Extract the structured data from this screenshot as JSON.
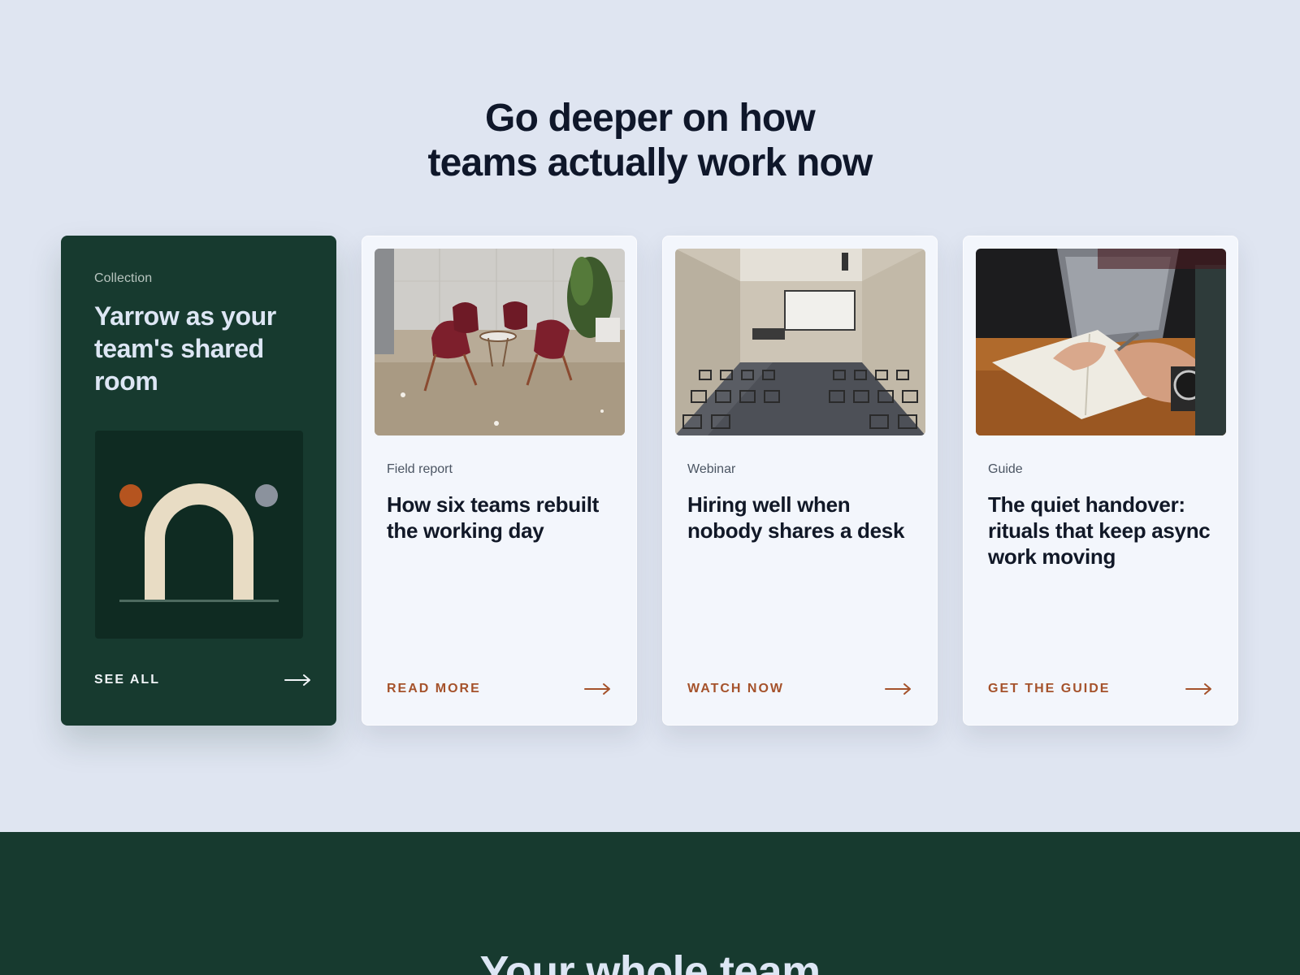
{
  "section": {
    "headline_line1": "Go deeper on how",
    "headline_line2": "teams actually work now"
  },
  "feature_card": {
    "kicker": "Collection",
    "title": "Yarrow as your team's shared room",
    "cta_label": "SEE ALL",
    "icons": {
      "art": "arch-illustration",
      "arrow": "arrow-right-icon"
    },
    "colors": {
      "background": "#173a2f",
      "arch": "#e8dcc4",
      "dot_left": "#b5541f",
      "dot_right": "#8b929d"
    }
  },
  "articles": [
    {
      "kicker": "Field report",
      "title": "How six teams rebuilt the working day",
      "cta_label": "READ MORE",
      "image": "lounge-chairs-photo"
    },
    {
      "kicker": "Webinar",
      "title": "Hiring well when nobody shares a desk",
      "cta_label": "WATCH NOW",
      "image": "conference-room-photo"
    },
    {
      "kicker": "Guide",
      "title": "The quiet handover: rituals that keep async work moving",
      "cta_label": "GET THE GUIDE",
      "image": "notebook-writing-photo"
    }
  ],
  "accent_color": "#a5522b",
  "footer": {
    "heading": "Your whole team"
  }
}
